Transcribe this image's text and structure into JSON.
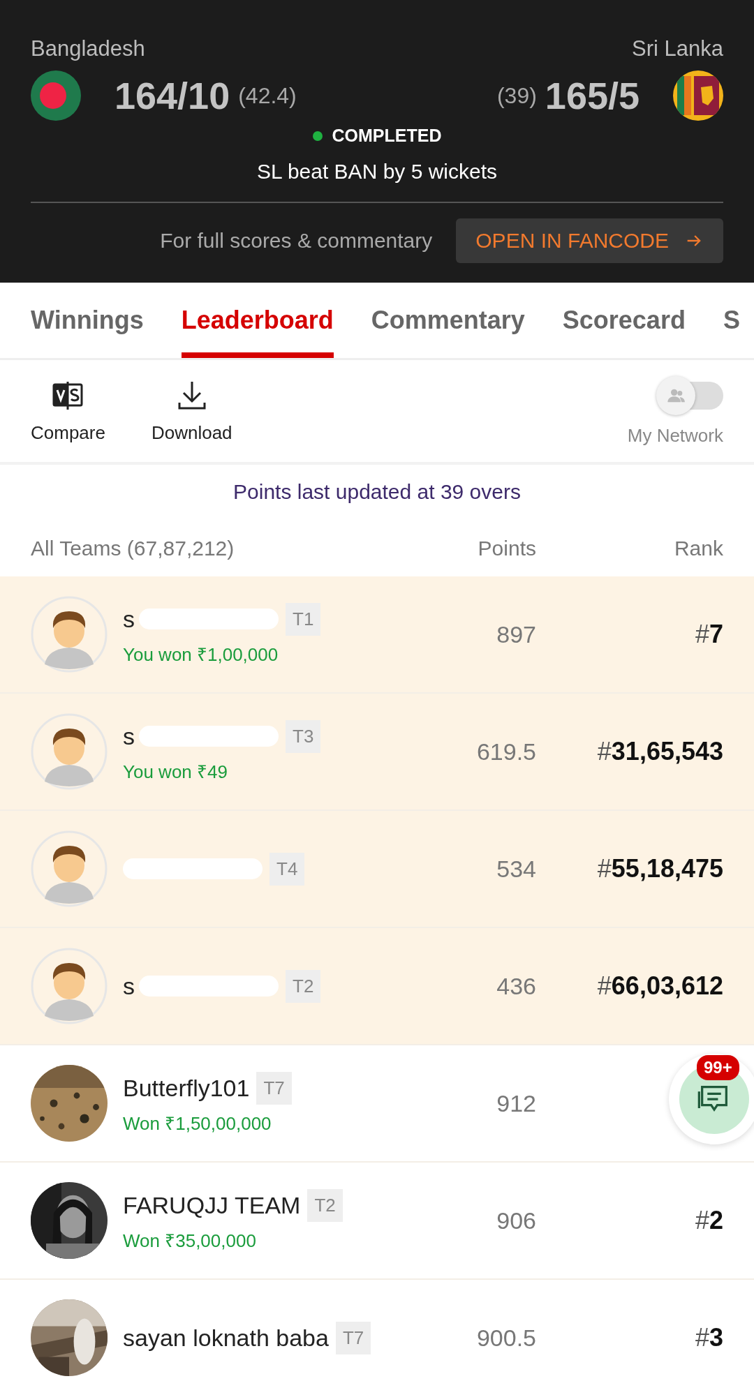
{
  "match": {
    "teams": [
      {
        "name": "Bangladesh",
        "score": "164/10",
        "overs": "(42.4)",
        "kind": "bangladesh"
      },
      {
        "name": "Sri Lanka",
        "score": "165/5",
        "overs": "(39)",
        "kind": "sri_lanka"
      }
    ],
    "status": "COMPLETED",
    "result": "SL beat BAN by 5 wickets",
    "cta_text": "For full scores & commentary",
    "cta_button": "OPEN IN FANCODE"
  },
  "tabs": [
    {
      "label": "Winnings",
      "selected": false
    },
    {
      "label": "Leaderboard",
      "selected": true
    },
    {
      "label": "Commentary",
      "selected": false
    },
    {
      "label": "Scorecard",
      "selected": false
    },
    {
      "label": "S",
      "selected": false
    }
  ],
  "toolbar": {
    "compare": "Compare",
    "download": "Download",
    "network": {
      "label": "My Network",
      "on": false
    }
  },
  "points_note": "Points last updated at 39 overs",
  "columns": [
    "All Teams (67,87,212)",
    "Points",
    "Rank"
  ],
  "rows": [
    {
      "name": "s",
      "redacted": true,
      "team": "T1",
      "winnings": "You won ₹1,00,000",
      "points": "897",
      "rank": "#**7**",
      "mine": true,
      "kind": "default"
    },
    {
      "name": "s",
      "redacted": true,
      "team": "T3",
      "winnings": "You won ₹49",
      "points": "619.5",
      "rank": "#**31,65,543**",
      "mine": true,
      "kind": "default"
    },
    {
      "redacted": true,
      "team": "T4",
      "points": "534",
      "rank": "#**55,18,475**",
      "mine": true,
      "kind": "default"
    },
    {
      "name": "s",
      "redacted": true,
      "team": "T2",
      "points": "436",
      "rank": "#**66,03,612**",
      "mine": true,
      "kind": "default"
    },
    {
      "name": "Butterfly101",
      "redacted": false,
      "team": "T7",
      "winnings": "Won ₹1,50,00,000",
      "points": "912",
      "mine": false,
      "kind": "picture"
    },
    {
      "name": "FARUQJJ TEAM",
      "redacted": false,
      "team": "T2",
      "winnings": "Won ₹35,00,000",
      "points": "906",
      "rank": "#**2**",
      "mine": false,
      "kind": "picture"
    },
    {
      "name": "sayan loknath baba",
      "redacted": false,
      "team": "T7",
      "points": "900.5",
      "rank": "#**3**",
      "mine": false,
      "kind": "picture"
    }
  ],
  "chat": {
    "badge": "99+"
  }
}
